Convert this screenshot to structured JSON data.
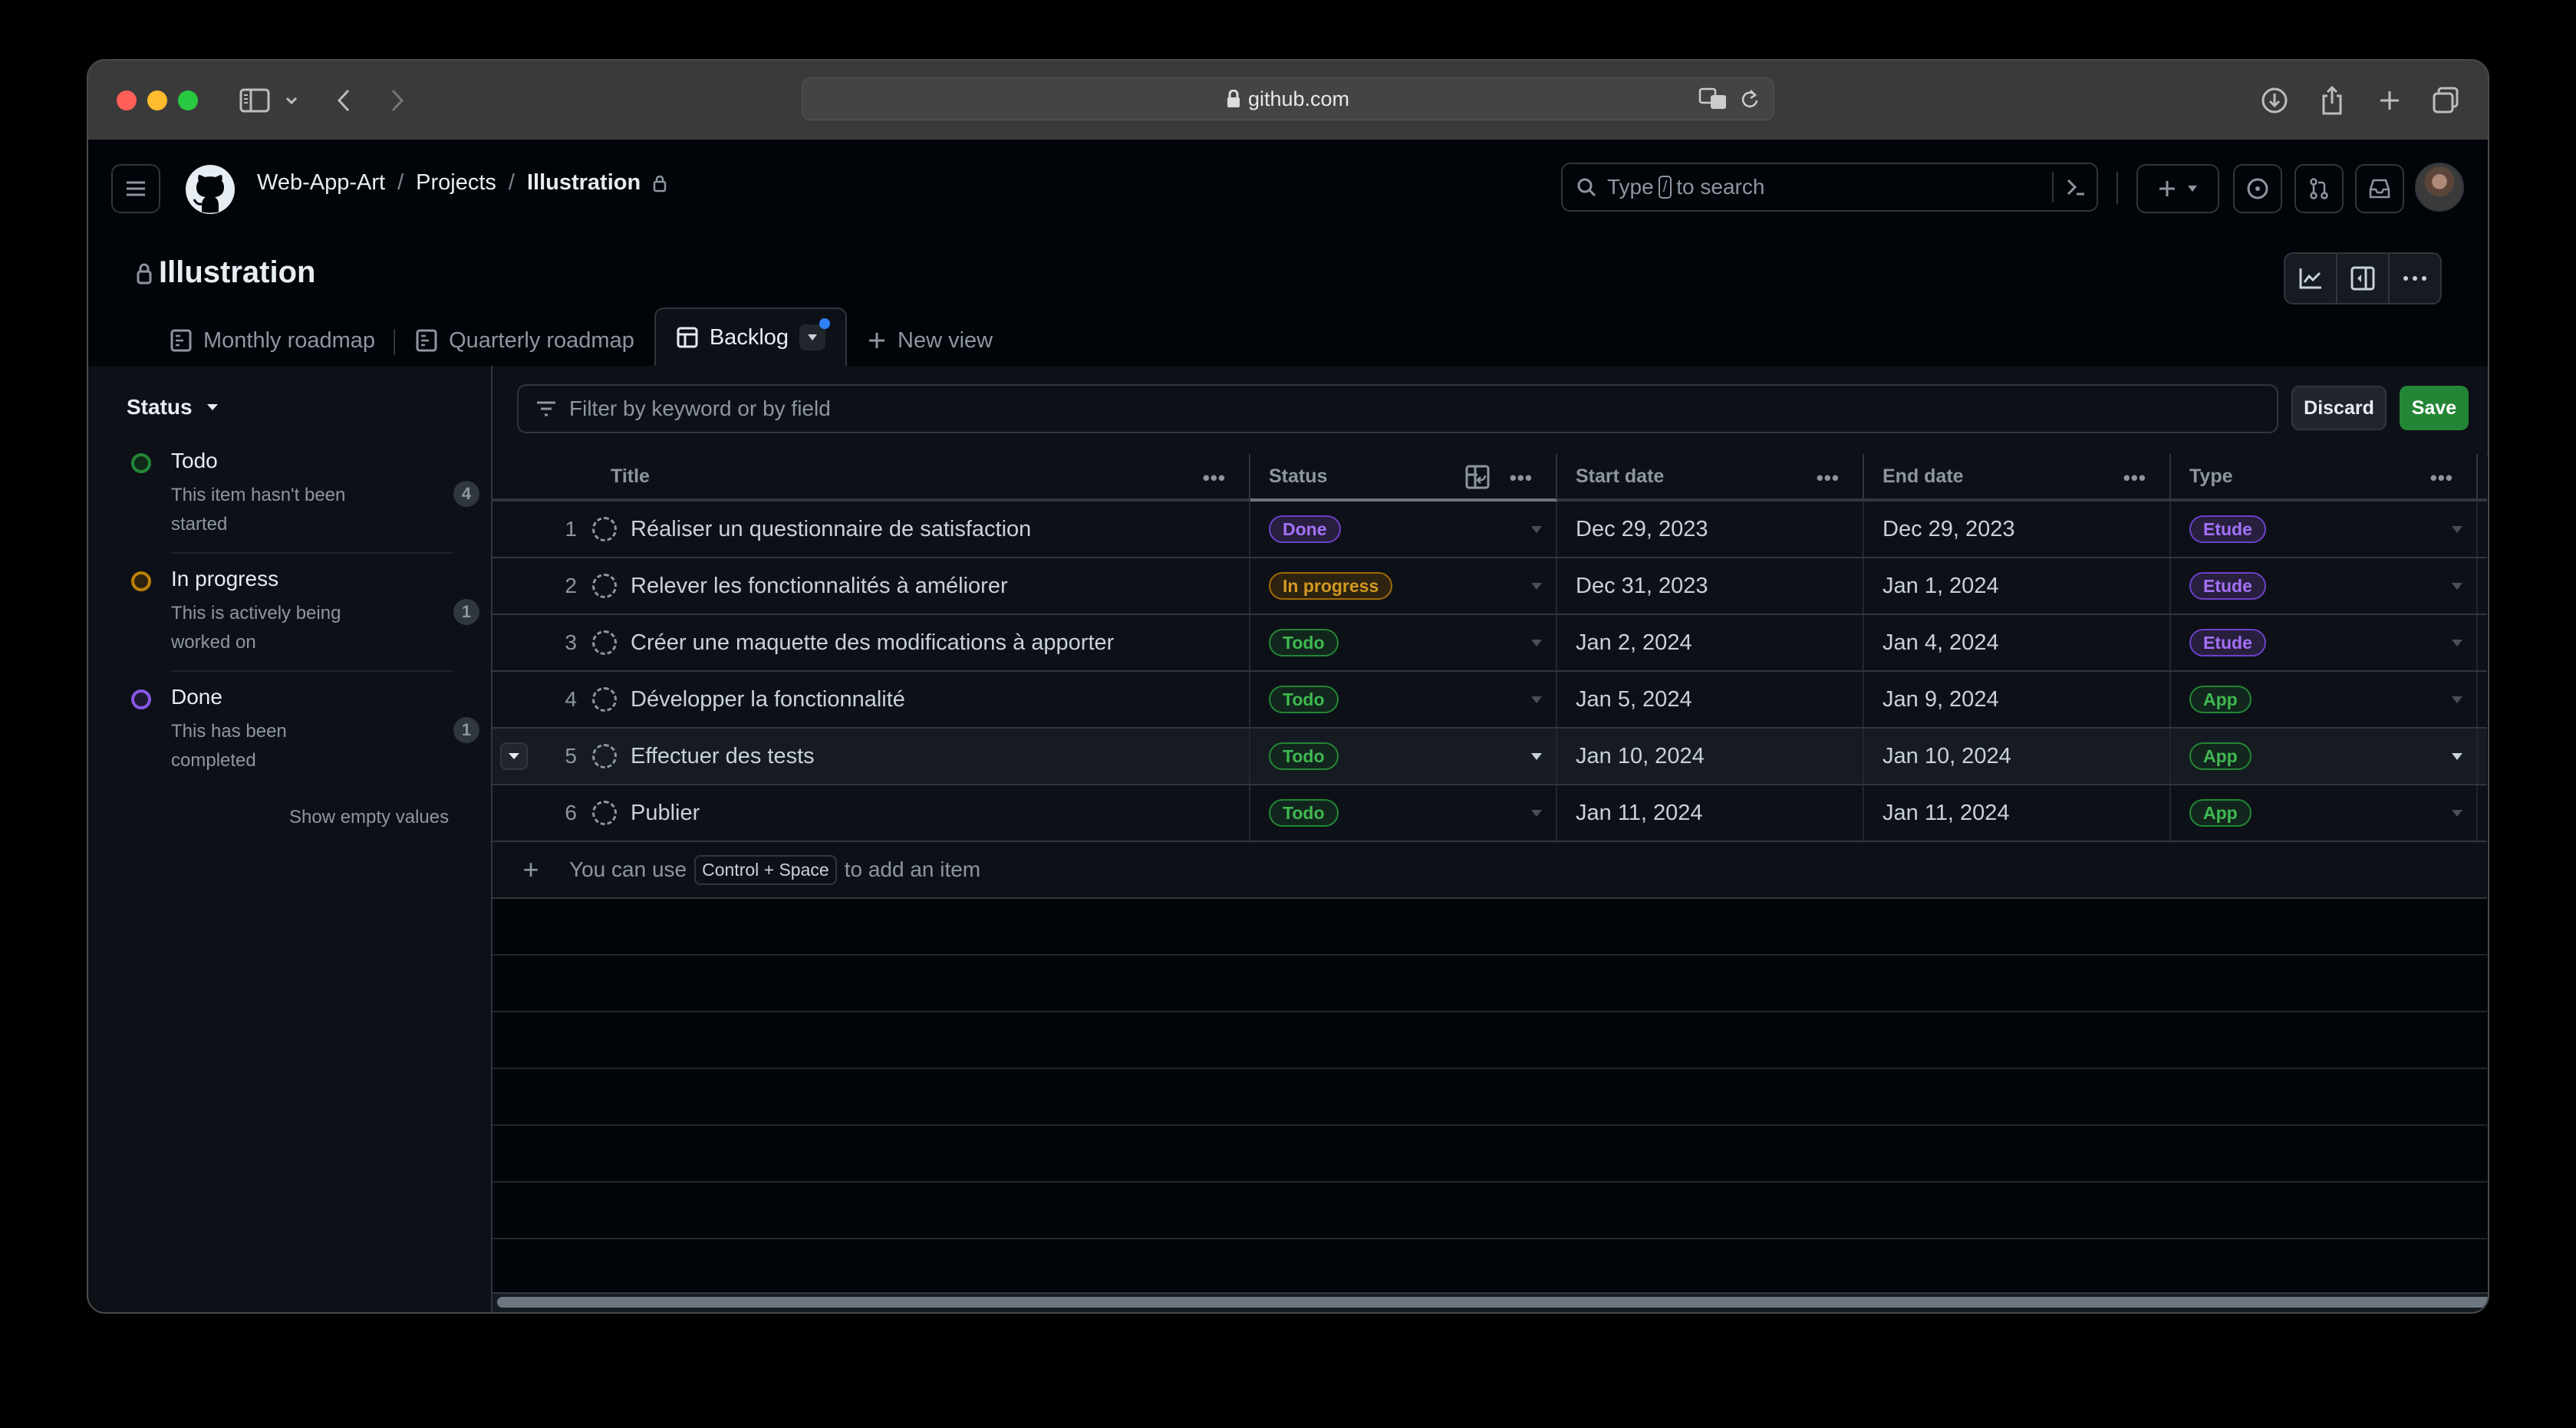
{
  "browser": {
    "url": "github.com"
  },
  "header": {
    "breadcrumb": [
      "Web-App-Art",
      "Projects",
      "Illustration"
    ],
    "search_placeholder_pre": "Type",
    "search_key": "/",
    "search_placeholder_post": "to search"
  },
  "project": {
    "title": "Illustration",
    "tabs": [
      {
        "label": "Monthly roadmap",
        "icon": "roadmap-icon"
      },
      {
        "label": "Quarterly roadmap",
        "icon": "roadmap-icon"
      },
      {
        "label": "Backlog",
        "icon": "table-icon",
        "active": true
      },
      {
        "label": "New view",
        "icon": "plus-icon"
      }
    ]
  },
  "sidebar": {
    "group_label": "Status",
    "items": [
      {
        "name": "Todo",
        "description": "This item hasn't been started",
        "count": "4",
        "color": "#238636"
      },
      {
        "name": "In progress",
        "description": "This is actively being worked on",
        "count": "1",
        "color": "#bb8009"
      },
      {
        "name": "Done",
        "description": "This has been completed",
        "count": "1",
        "color": "#8957e5"
      }
    ],
    "show_empty": "Show empty values"
  },
  "toolbar": {
    "filter_placeholder": "Filter by keyword or by field",
    "discard_label": "Discard",
    "save_label": "Save"
  },
  "table": {
    "columns": [
      "Title",
      "Status",
      "Start date",
      "End date",
      "Type"
    ],
    "rows": [
      {
        "num": "1",
        "title": "Réaliser un questionnaire de satisfaction",
        "status": "Done",
        "start": "Dec 29, 2023",
        "end": "Dec 29, 2023",
        "type": "Etude"
      },
      {
        "num": "2",
        "title": "Relever les fonctionnalités à améliorer",
        "status": "In progress",
        "start": "Dec 31, 2023",
        "end": "Jan 1, 2024",
        "type": "Etude"
      },
      {
        "num": "3",
        "title": "Créer une maquette des modifications à apporter",
        "status": "Todo",
        "start": "Jan 2, 2024",
        "end": "Jan 4, 2024",
        "type": "Etude"
      },
      {
        "num": "4",
        "title": "Développer la fonctionnalité",
        "status": "Todo",
        "start": "Jan 5, 2024",
        "end": "Jan 9, 2024",
        "type": "App"
      },
      {
        "num": "5",
        "title": "Effectuer des tests",
        "status": "Todo",
        "start": "Jan 10, 2024",
        "end": "Jan 10, 2024",
        "type": "App"
      },
      {
        "num": "6",
        "title": "Publier",
        "status": "Todo",
        "start": "Jan 11, 2024",
        "end": "Jan 11, 2024",
        "type": "App"
      }
    ],
    "add_hint_pre": "You can use",
    "add_hint_key": "Control + Space",
    "add_hint_post": "to add an item"
  },
  "pill_colors": {
    "Done": {
      "fg": "#a371f7",
      "bg": "#271f3d",
      "border": "#6e40c9"
    },
    "In progress": {
      "fg": "#d29922",
      "bg": "#2e2310",
      "border": "#9e6a03"
    },
    "Todo": {
      "fg": "#3fb950",
      "bg": "#12261e",
      "border": "#238636"
    },
    "Etude": {
      "fg": "#a371f7",
      "bg": "#271f3d",
      "border": "#6e40c9"
    },
    "App": {
      "fg": "#3fb950",
      "bg": "#12261e",
      "border": "#238636"
    }
  }
}
